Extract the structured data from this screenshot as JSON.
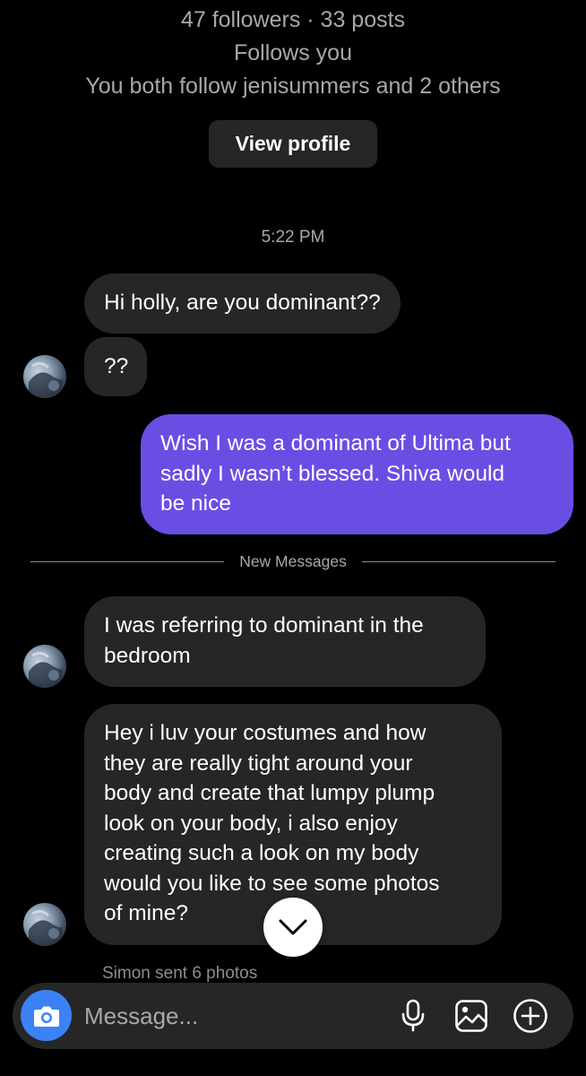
{
  "profile": {
    "stats": "47 followers · 33 posts",
    "follows_status": "Follows you",
    "mutuals": "You both follow jenisummers and 2 others",
    "view_profile_label": "View profile"
  },
  "thread": {
    "timestamp": "5:22 PM",
    "new_messages_label": "New Messages",
    "messages": [
      {
        "from": "them",
        "text": "Hi holly, are you dominant??"
      },
      {
        "from": "them",
        "text": "??"
      },
      {
        "from": "me",
        "text": "Wish I was a dominant of Ultima but\nsadly I wasn’t blessed. Shiva would\nbe nice"
      },
      {
        "from": "them",
        "text": "I was referring to dominant in the\nbedroom"
      },
      {
        "from": "them",
        "text": "Hey i luv your costumes and how\nthey are really tight around your\nbody and create that lumpy plump\nlook on your body, i also enjoy\ncreating such a look on my body\nwould you like to see some photos\nof mine?"
      }
    ],
    "sent_photos_notice": "Simon sent 6 photos"
  },
  "composer": {
    "placeholder": "Message..."
  },
  "icons": {
    "camera": "camera-icon",
    "microphone": "microphone-icon",
    "gallery": "gallery-icon",
    "add": "plus-circle-icon",
    "scroll_down": "chevron-down-icon"
  },
  "colors": {
    "background": "#000000",
    "received_bubble": "#262626",
    "sent_bubble": "#6a4ee4",
    "camera_button": "#3b82f6",
    "secondary_text": "#a8a8a8"
  }
}
